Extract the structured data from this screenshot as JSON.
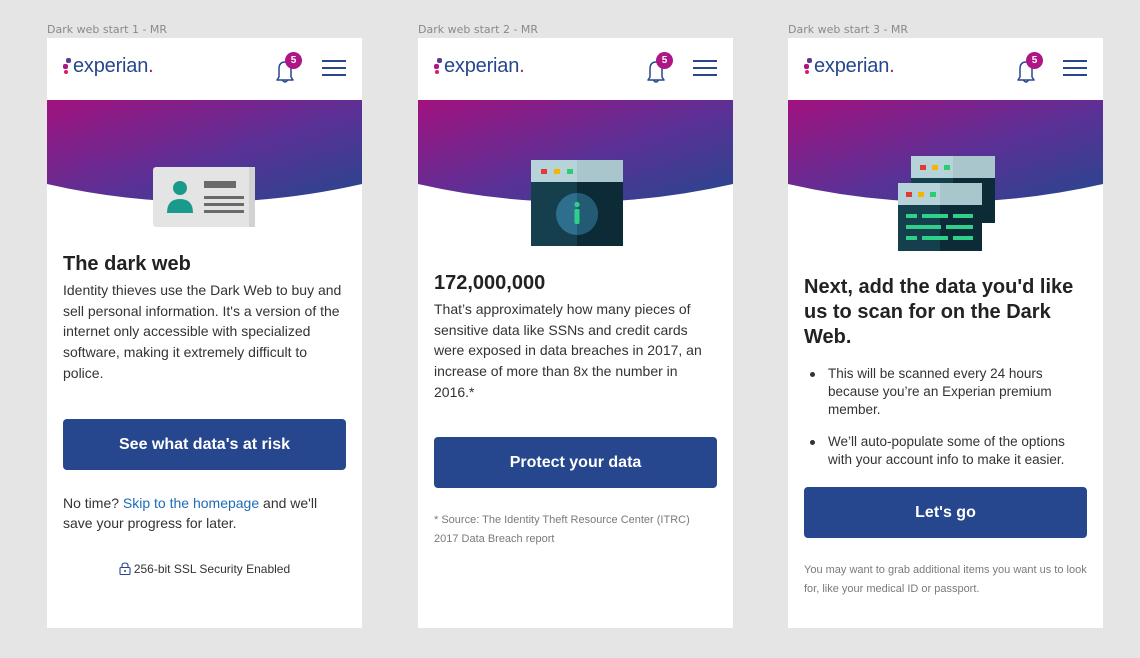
{
  "screens": [
    {
      "frame_label": "Dark web start 1 - MR",
      "notification_count": "5",
      "title": "The dark web",
      "body": "Identity thieves use the Dark Web to buy and sell personal information. It's a version of the internet only accessible with specialized software, making it extremely difficult to police.",
      "button": "See what data's at risk",
      "note_prefix": "No time? ",
      "note_link": "Skip to the homepage",
      "note_suffix": " and we'll save your progress for later.",
      "security": "256-bit SSL Security Enabled"
    },
    {
      "frame_label": "Dark web start 2 - MR",
      "notification_count": "5",
      "title": "172,000,000",
      "body": "That’s approximately how many pieces of sensitive data like SSNs and credit cards were exposed in data breaches in 2017, an increase of more than 8x the number in 2016.*",
      "button": "Protect your data",
      "footnote": "* Source: The Identity Theft Resource Center (ITRC) 2017 Data Breach report"
    },
    {
      "frame_label": "Dark web start 3 - MR",
      "notification_count": "5",
      "title": "Next, add the data you'd like us to scan for on the Dark Web.",
      "bullets": [
        "This will be scanned every 24 hours because you’re an Experian premium member.",
        "We’ll auto-populate some of the options with your account info to make it easier."
      ],
      "button": "Let's go",
      "footnote": "You may want to grab additional items you want us to look for, like your medical ID or passport."
    }
  ],
  "brand": {
    "logo_text": "experian",
    "logo_period": ".",
    "primary_color": "#26478d",
    "accent_color": "#af1685",
    "gradient": [
      "#a2127f",
      "#4a3393",
      "#26478d"
    ]
  },
  "icons": [
    "bell-icon",
    "hamburger-menu-icon",
    "lock-icon",
    "id-card-icon",
    "browser-info-icon",
    "browser-data-icon"
  ]
}
